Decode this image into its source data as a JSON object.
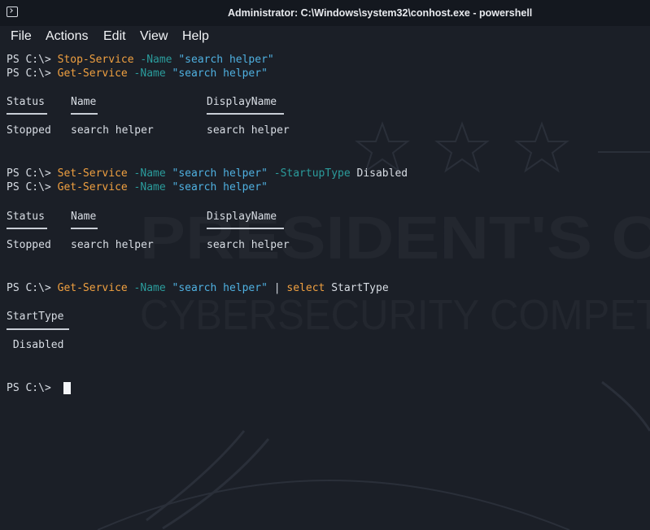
{
  "window": {
    "title": "Administrator: C:\\Windows\\system32\\conhost.exe - powershell",
    "icon": "terminal-icon"
  },
  "menu": [
    "File",
    "Actions",
    "Edit",
    "View",
    "Help"
  ],
  "watermark": {
    "line1": "PRESIDENT'S C",
    "line2": "CYBERSECURITY COMPET"
  },
  "terminal": {
    "prompt": "PS C:\\> ",
    "cmd1": {
      "cmdlet": "Stop-Service",
      "param": " -Name ",
      "value": "\"search helper\""
    },
    "cmd2": {
      "cmdlet": "Get-Service",
      "param": " -Name ",
      "value": "\"search helper\""
    },
    "table1": {
      "headers": [
        "Status",
        "Name",
        "DisplayName"
      ],
      "row": [
        "Stopped",
        "search helper",
        "search helper"
      ]
    },
    "cmd3": {
      "cmdlet": "Set-Service",
      "param": " -Name ",
      "value": "\"search helper\"",
      "param2": " -StartupType ",
      "value2": "Disabled"
    },
    "cmd4": {
      "cmdlet": "Get-Service",
      "param": " -Name ",
      "value": "\"search helper\""
    },
    "table2": {
      "headers": [
        "Status",
        "Name",
        "DisplayName"
      ],
      "row": [
        "Stopped",
        "search helper",
        "search helper"
      ]
    },
    "cmd5": {
      "cmdlet": "Get-Service",
      "param": " -Name ",
      "value": "\"search helper\"",
      "pipe": " | ",
      "select": "select",
      "arg": " StartType"
    },
    "table3": {
      "header": "StartType",
      "value": " Disabled"
    },
    "final_prompt": "PS C:\\> "
  },
  "colors": {
    "background": "#1b1f27",
    "cmdlet": "#f0a040",
    "parameter": "#2b9c9c",
    "string": "#4fb0e0"
  }
}
